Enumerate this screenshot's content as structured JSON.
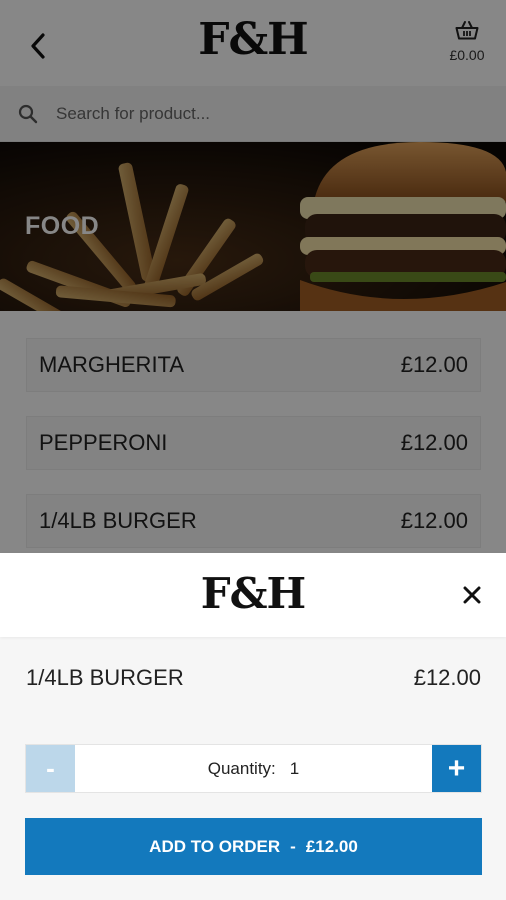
{
  "header": {
    "logo": "F&H",
    "basket_total": "£0.00"
  },
  "search": {
    "placeholder": "Search for product..."
  },
  "banner": {
    "title": "FOOD"
  },
  "products": [
    {
      "name": "MARGHERITA",
      "price": "£12.00"
    },
    {
      "name": "PEPPERONI",
      "price": "£12.00"
    },
    {
      "name": "1/4LB BURGER",
      "price": "£12.00"
    }
  ],
  "modal": {
    "logo": "F&H",
    "item_name": "1/4LB BURGER",
    "item_price": "£12.00",
    "quantity_label": "Quantity:",
    "quantity_value": "1",
    "minus_label": "-",
    "plus_label": "+",
    "add_label": "ADD TO ORDER",
    "add_separator": "-",
    "add_price": "£12.00"
  },
  "colors": {
    "accent": "#1379bd",
    "accent_disabled": "#bcd7ea"
  },
  "icons": [
    "back-arrow-icon",
    "basket-icon",
    "search-icon",
    "close-icon"
  ]
}
